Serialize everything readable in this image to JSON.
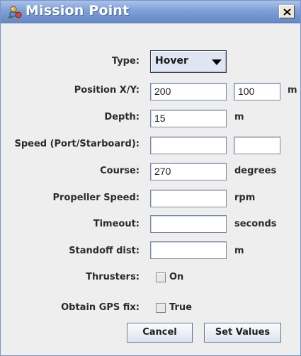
{
  "window": {
    "title": "Mission Point",
    "title_icon": "robot-icon",
    "close_icon": "close-icon"
  },
  "form": {
    "type": {
      "label": "Type:",
      "selected": "Hover",
      "arrow_icon": "dropdown-arrow-icon"
    },
    "position": {
      "label": "Position X/Y:",
      "x_value": "200",
      "y_value": "100",
      "unit": "m"
    },
    "depth": {
      "label": "Depth:",
      "value": "15",
      "unit": "m"
    },
    "speed": {
      "label": "Speed (Port/Starboard):",
      "port_value": "",
      "starboard_value": ""
    },
    "course": {
      "label": "Course:",
      "value": "270",
      "unit": "degrees"
    },
    "propeller_speed": {
      "label": "Propeller Speed:",
      "value": "",
      "unit": "rpm"
    },
    "timeout": {
      "label": "Timeout:",
      "value": "",
      "unit": "seconds"
    },
    "standoff": {
      "label": "Standoff dist:",
      "value": "",
      "unit": "m"
    },
    "thrusters": {
      "label": "Thrusters:",
      "checkbox_label": "On",
      "checked": false
    },
    "gps": {
      "label": "Obtain GPS fix:",
      "checkbox_label": "True",
      "checked": false
    }
  },
  "buttons": {
    "cancel": "Cancel",
    "set_values": "Set Values"
  },
  "colors": {
    "titlebar": "#7f9fd6",
    "dialog_bg": "#eeeeee",
    "field_border": "#7a8aa0"
  }
}
